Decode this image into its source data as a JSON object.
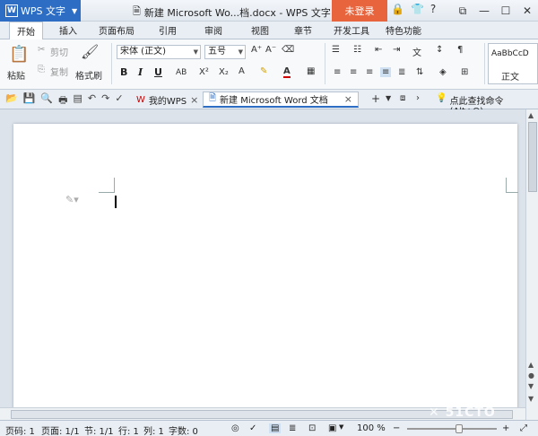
{
  "titlebar": {
    "app_name": "WPS 文字",
    "document_title": "新建 Microsoft Wo...档.docx - WPS 文字",
    "login_label": "未登录"
  },
  "menu": {
    "tabs": [
      "开始",
      "插入",
      "页面布局",
      "引用",
      "审阅",
      "视图",
      "章节",
      "开发工具",
      "特色功能"
    ]
  },
  "ribbon": {
    "paste_label": "粘贴",
    "cut_label": "剪切",
    "copy_label": "复制",
    "format_painter_label": "格式刷",
    "font_name": "宋体 (正文)",
    "font_size": "五号",
    "style_preview": "AaBbCcD",
    "style_name": "正文"
  },
  "doc_tabs": {
    "home_tab": "我的WPS",
    "active_tab": "新建 Microsoft Word 文档",
    "search_command": "点此查找命令 (Alt+Q)"
  },
  "statusbar": {
    "page_num": "页码: 1",
    "pages": "页面: 1/1",
    "section": "节: 1/1",
    "row": "行: 1",
    "column": "列: 1",
    "word_count": "字数: 0",
    "zoom": "100 %"
  },
  "zoom_level": 100,
  "colors": {
    "accent": "#2d6ec4",
    "login": "#e8643c"
  }
}
